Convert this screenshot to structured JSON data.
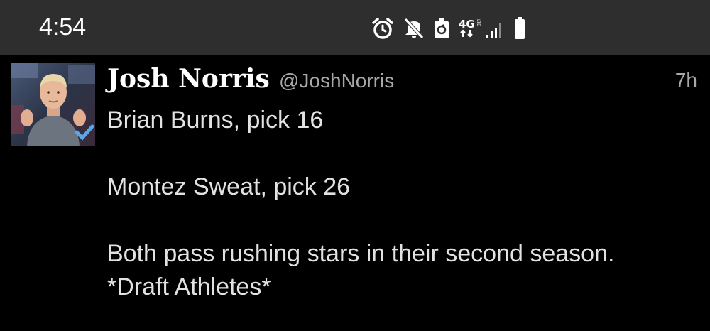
{
  "status_bar": {
    "time": "4:54",
    "network_label": "4G",
    "network_sub": "LTE",
    "icons": [
      "alarm-icon",
      "mute-icon",
      "data-saver-icon",
      "network-icon",
      "signal-icon",
      "battery-icon"
    ]
  },
  "tweet": {
    "author_name": "Josh Norris",
    "author_handle": "@JoshNorris",
    "age": "7h",
    "avatar": "avatar-photo",
    "lines": [
      "Brian Burns, pick 16",
      "Montez Sweat, pick 26",
      "Both pass rushing stars in their second season.",
      "*Draft Athletes*"
    ]
  }
}
